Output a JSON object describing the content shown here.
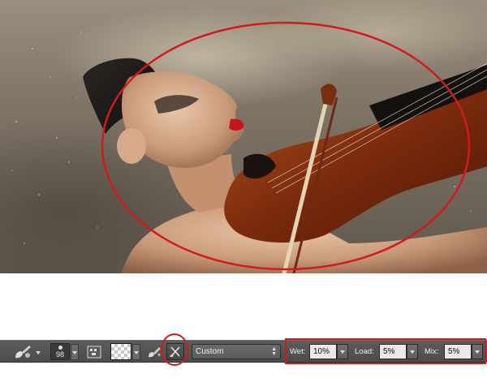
{
  "photo": {
    "description_alt": "Woman playing violin",
    "annotation_color": "#d11a1a"
  },
  "toolbar": {
    "brush_size": "98",
    "mixer_preset": "Custom",
    "wet_label": "Wet:",
    "wet_value": "10%",
    "load_label": "Load:",
    "load_value": "5%",
    "mix_label": "Mix:",
    "mix_value": "5%",
    "icons": {
      "tool": "mixer-brush-icon",
      "brush_panel": "brush-panel-icon",
      "load_brush": "load-brush-icon",
      "clean_brush": "clean-brush-icon"
    },
    "colors": {
      "bar": "#4f4f4f",
      "field_bg": "#e9e9e9",
      "text": "#f0f0f0"
    }
  }
}
